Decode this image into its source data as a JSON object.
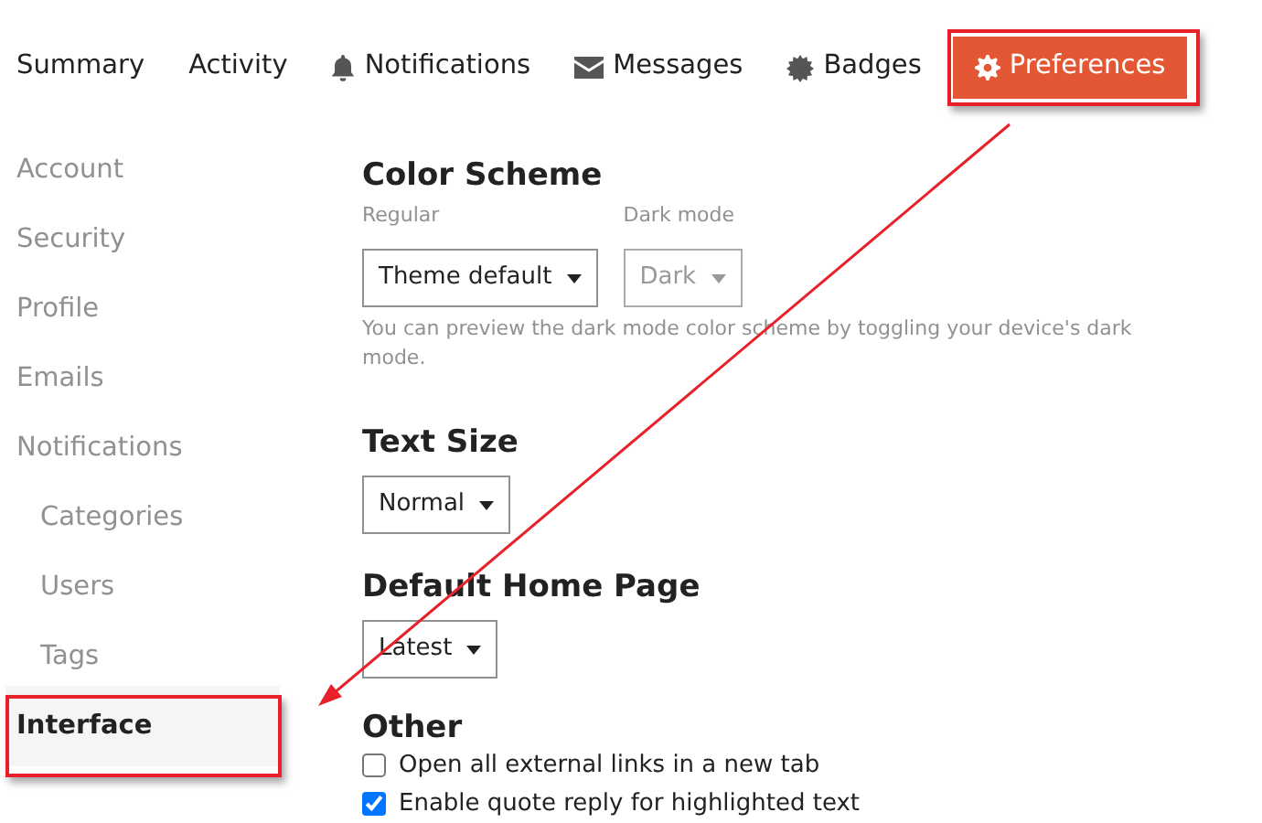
{
  "nav_tabs": [
    {
      "label": "Summary",
      "selected": false
    },
    {
      "label": "Activity",
      "selected": false
    },
    {
      "label": "Notifications",
      "selected": false
    },
    {
      "label": "Messages",
      "selected": false
    },
    {
      "label": "Badges",
      "selected": false
    },
    {
      "label": "Preferences",
      "selected": true
    }
  ],
  "sidebar": {
    "items": [
      {
        "label": "Account",
        "selected": false
      },
      {
        "label": "Security",
        "selected": false
      },
      {
        "label": "Profile",
        "selected": false
      },
      {
        "label": "Emails",
        "selected": false
      },
      {
        "label": "Notifications",
        "selected": false,
        "children": [
          {
            "label": "Categories",
            "selected": false
          },
          {
            "label": "Users",
            "selected": false
          },
          {
            "label": "Tags",
            "selected": false
          }
        ]
      },
      {
        "label": "Interface",
        "selected": true
      }
    ]
  },
  "sections": [
    {
      "kind": "selects",
      "title": "Color Scheme",
      "selects": [
        {
          "label": "Regular",
          "value": "Theme default",
          "disabled": false
        },
        {
          "label": "Dark mode",
          "value": "Dark",
          "disabled": true
        }
      ],
      "help": "You can preview the dark mode color scheme by toggling your device's dark mode."
    },
    {
      "kind": "selects",
      "title": "Text Size",
      "selects": [
        {
          "value": "Normal",
          "disabled": false
        }
      ]
    },
    {
      "kind": "selects",
      "title": "Default Home Page",
      "selects": [
        {
          "value": "Latest",
          "disabled": false
        }
      ]
    },
    {
      "kind": "checkboxes",
      "title": "Other",
      "options": [
        {
          "label": "Open all external links in a new tab",
          "checked": false
        },
        {
          "label": "Enable quote reply for highlighted text",
          "checked": true
        }
      ]
    }
  ]
}
